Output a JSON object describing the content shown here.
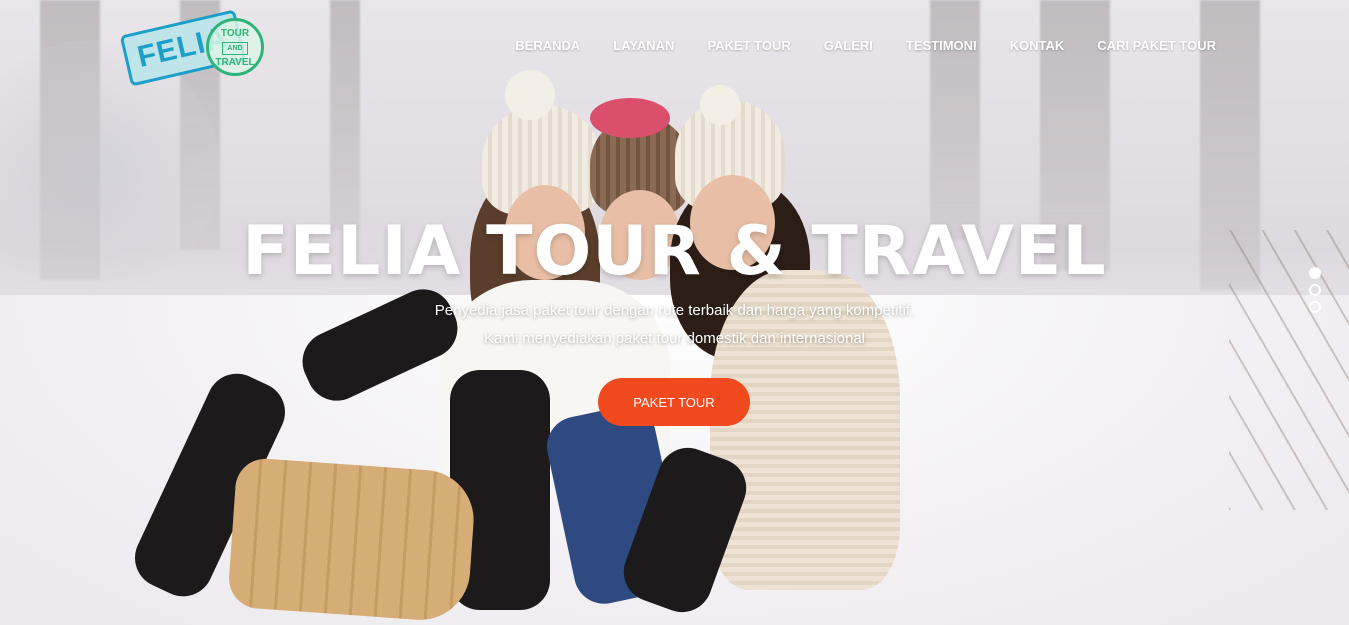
{
  "logo": {
    "brand": "FELIA",
    "stamp_top": "TOUR",
    "stamp_middle": "AND",
    "stamp_bottom": "TRAVEL"
  },
  "nav": {
    "items": [
      {
        "label": "BERANDA"
      },
      {
        "label": "LAYANAN"
      },
      {
        "label": "PAKET TOUR"
      },
      {
        "label": "GALERI"
      },
      {
        "label": "TESTIMONI"
      },
      {
        "label": "KONTAK"
      },
      {
        "label": "CARI PAKET TOUR"
      }
    ]
  },
  "hero": {
    "title": "FELIA TOUR & TRAVEL",
    "desc_line1": "Penyedia jasa paket tour dengan rute terbaik dan harga yang kompetitif.",
    "desc_line2": "Kami menyediakan paket tour domestik dan internasional",
    "cta_label": "PAKET TOUR",
    "cta_color": "#f24a1f"
  },
  "slider": {
    "count": 3,
    "active_index": 0
  }
}
